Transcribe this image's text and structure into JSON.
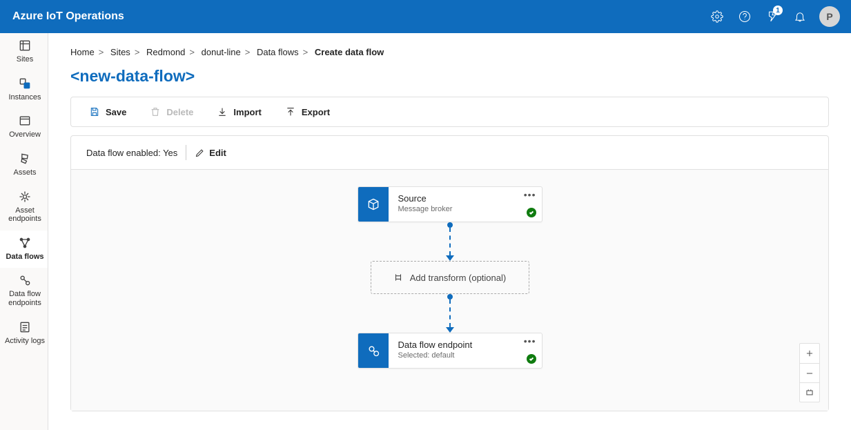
{
  "app_title": "Azure IoT Operations",
  "notifications_badge": "1",
  "avatar_initial": "P",
  "sidebar": {
    "items": [
      {
        "label": "Sites"
      },
      {
        "label": "Instances"
      },
      {
        "label": "Overview"
      },
      {
        "label": "Assets"
      },
      {
        "label": "Asset endpoints"
      },
      {
        "label": "Data flows"
      },
      {
        "label": "Data flow endpoints"
      },
      {
        "label": "Activity logs"
      }
    ],
    "selected_index": 5
  },
  "breadcrumb": [
    "Home",
    "Sites",
    "Redmond",
    "donut-line",
    "Data flows",
    "Create data flow"
  ],
  "page_title": "<new-data-flow>",
  "toolbar": {
    "save": "Save",
    "delete": "Delete",
    "import": "Import",
    "export": "Export"
  },
  "dataflow": {
    "status_label": "Data flow enabled:",
    "status_value": "Yes",
    "edit_label": "Edit"
  },
  "flow_nodes": {
    "source": {
      "title": "Source",
      "sub": "Message broker"
    },
    "transform": {
      "label": "Add transform (optional)"
    },
    "endpoint": {
      "title": "Data flow endpoint",
      "sub": "Selected: default"
    }
  }
}
